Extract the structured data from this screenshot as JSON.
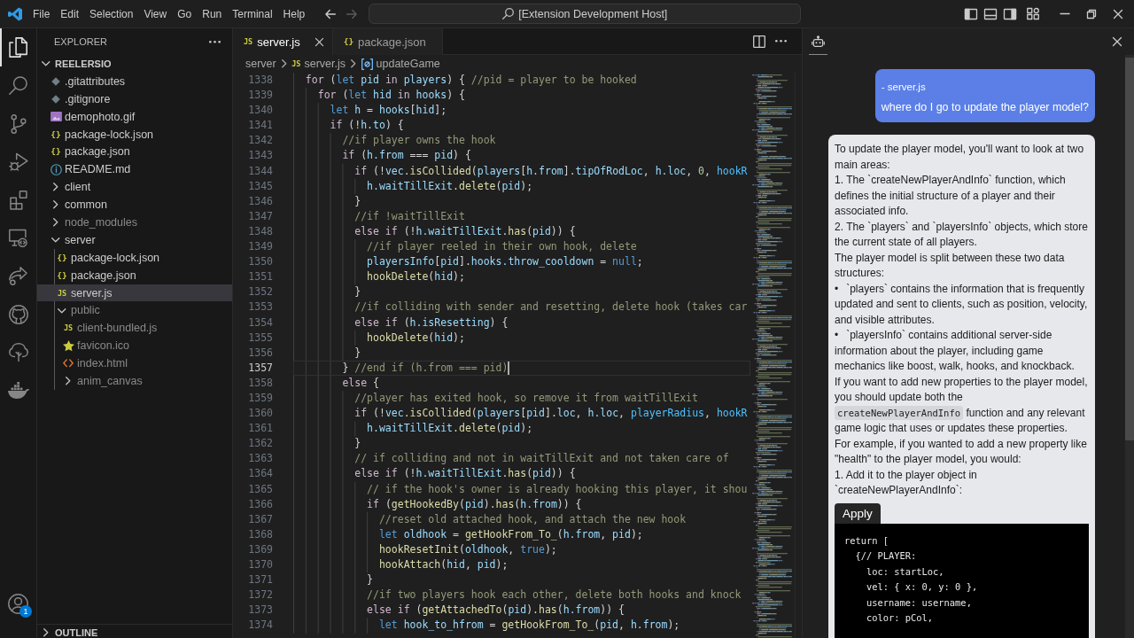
{
  "title_bar": {
    "menu": [
      "File",
      "Edit",
      "Selection",
      "View",
      "Go",
      "Run",
      "Terminal",
      "Help"
    ],
    "navigation": [
      {
        "kind": "back",
        "disabled": false
      },
      {
        "kind": "forward",
        "disabled": true
      }
    ],
    "command_center": "[Extension Development Host]"
  },
  "activity_bar": {
    "items": [
      {
        "kind": "explorer",
        "selected": true
      },
      {
        "kind": "search",
        "selected": false
      },
      {
        "kind": "source_control",
        "selected": false
      },
      {
        "kind": "run_debug",
        "selected": false
      },
      {
        "kind": "extensions",
        "selected": false
      },
      {
        "kind": "remote",
        "selected": false
      },
      {
        "kind": "share",
        "selected": false
      },
      {
        "kind": "github",
        "selected": false
      },
      {
        "kind": "tree",
        "selected": false
      },
      {
        "kind": "docker",
        "selected": false
      }
    ],
    "account_badge": "1"
  },
  "sidebar": {
    "title": "EXPLORER",
    "tree": {
      "label": "REELERSIO",
      "expanded": true,
      "children": [
        {
          "label": ".gitattributes",
          "kind": "config",
          "selected": false,
          "dimmed": false
        },
        {
          "label": ".gitignore",
          "kind": "config",
          "selected": false,
          "dimmed": false
        },
        {
          "label": "demophoto.gif",
          "kind": "image",
          "selected": false,
          "dimmed": false
        },
        {
          "label": "package-lock.json",
          "kind": "json",
          "icon_label": "{}",
          "selected": false,
          "dimmed": false
        },
        {
          "label": "package.json",
          "kind": "json",
          "icon_label": "{}",
          "selected": false,
          "dimmed": false
        },
        {
          "label": "README.md",
          "kind": "info",
          "selected": false,
          "dimmed": false
        },
        {
          "label": "client",
          "kind": "folder",
          "expanded": false,
          "selected": false,
          "dimmed": false
        },
        {
          "label": "common",
          "kind": "folder",
          "expanded": false,
          "selected": false,
          "dimmed": false
        },
        {
          "label": "node_modules",
          "kind": "folder",
          "expanded": false,
          "selected": false,
          "dimmed": true
        },
        {
          "label": "server",
          "kind": "folder",
          "expanded": true,
          "selected": false,
          "dimmed": false,
          "children": [
            {
              "label": "package-lock.json",
              "kind": "json",
              "icon_label": "{}",
              "selected": false,
              "dimmed": false
            },
            {
              "label": "package.json",
              "kind": "json",
              "icon_label": "{}",
              "selected": false,
              "dimmed": false
            },
            {
              "label": "server.js",
              "kind": "javascript",
              "icon_label": "JS",
              "selected": true,
              "dimmed": false
            },
            {
              "label": "public",
              "kind": "folder",
              "expanded": true,
              "selected": false,
              "dimmed": true,
              "children": [
                {
                  "label": "client-bundled.js",
                  "kind": "javascript",
                  "icon_label": "JS",
                  "selected": false,
                  "dimmed": true
                },
                {
                  "label": "favicon.ico",
                  "kind": "favicon",
                  "selected": false,
                  "dimmed": true
                },
                {
                  "label": "index.html",
                  "kind": "html",
                  "selected": false,
                  "dimmed": true
                },
                {
                  "label": "anim_canvas",
                  "kind": "folder",
                  "expanded": false,
                  "selected": false,
                  "dimmed": true
                }
              ]
            }
          ]
        }
      ]
    },
    "outline": {
      "label": "OUTLINE",
      "expanded": false
    }
  },
  "editor": {
    "tabs": [
      {
        "label": "server.js",
        "kind": "javascript",
        "icon_label": "JS",
        "selected": true
      },
      {
        "label": "package.json",
        "kind": "json",
        "icon_label": "{}",
        "selected": false
      }
    ],
    "breadcrumbs": [
      {
        "label": "server",
        "kind": "folder"
      },
      {
        "label": "server.js",
        "kind": "javascript",
        "icon_label": "JS"
      },
      {
        "label": "updateGame",
        "kind": "symbol"
      }
    ],
    "lines": [
      {
        "number": "1338",
        "current": false,
        "tokens": [
          {
            "kind": "control",
            "text": "  for"
          },
          {
            "kind": "plain",
            "text": " ("
          },
          {
            "kind": "keyword",
            "text": "let"
          },
          {
            "kind": "variable",
            "text": " pid"
          },
          {
            "kind": "control",
            "text": " in"
          },
          {
            "kind": "variable",
            "text": " players"
          },
          {
            "kind": "plain",
            "text": ") { "
          },
          {
            "kind": "comment",
            "text": "//pid = player to be hooked"
          }
        ]
      },
      {
        "number": "1339",
        "current": false,
        "tokens": [
          {
            "kind": "control",
            "text": "    for"
          },
          {
            "kind": "plain",
            "text": " ("
          },
          {
            "kind": "keyword",
            "text": "let"
          },
          {
            "kind": "variable",
            "text": " hid"
          },
          {
            "kind": "control",
            "text": " in"
          },
          {
            "kind": "variable",
            "text": " hooks"
          },
          {
            "kind": "plain",
            "text": ") {"
          }
        ]
      },
      {
        "number": "1340",
        "current": false,
        "tokens": [
          {
            "kind": "keyword",
            "text": "      let"
          },
          {
            "kind": "variable",
            "text": " h"
          },
          {
            "kind": "plain",
            "text": " = "
          },
          {
            "kind": "variable",
            "text": "hooks"
          },
          {
            "kind": "plain",
            "text": "["
          },
          {
            "kind": "variable",
            "text": "hid"
          },
          {
            "kind": "plain",
            "text": "];"
          }
        ]
      },
      {
        "number": "1341",
        "current": false,
        "tokens": [
          {
            "kind": "control",
            "text": "      if"
          },
          {
            "kind": "plain",
            "text": " (!"
          },
          {
            "kind": "variable",
            "text": "h.to"
          },
          {
            "kind": "plain",
            "text": ") {"
          }
        ]
      },
      {
        "number": "1342",
        "current": false,
        "tokens": [
          {
            "kind": "comment",
            "text": "        //if player owns the hook"
          }
        ]
      },
      {
        "number": "1343",
        "current": false,
        "tokens": [
          {
            "kind": "control",
            "text": "        if"
          },
          {
            "kind": "plain",
            "text": " ("
          },
          {
            "kind": "variable",
            "text": "h.from"
          },
          {
            "kind": "plain",
            "text": " === "
          },
          {
            "kind": "variable",
            "text": "pid"
          },
          {
            "kind": "plain",
            "text": ") {"
          }
        ]
      },
      {
        "number": "1344",
        "current": false,
        "tokens": [
          {
            "kind": "control",
            "text": "          if"
          },
          {
            "kind": "plain",
            "text": " (!"
          },
          {
            "kind": "variable",
            "text": "vec"
          },
          {
            "kind": "function",
            "text": ".isCollided"
          },
          {
            "kind": "plain",
            "text": "("
          },
          {
            "kind": "variable",
            "text": "players"
          },
          {
            "kind": "plain",
            "text": "["
          },
          {
            "kind": "variable",
            "text": "h.from"
          },
          {
            "kind": "plain",
            "text": "]."
          },
          {
            "kind": "variable",
            "text": "tipOfRodLoc"
          },
          {
            "kind": "plain",
            "text": ", "
          },
          {
            "kind": "variable",
            "text": "h.loc"
          },
          {
            "kind": "plain",
            "text": ", "
          },
          {
            "kind": "number",
            "text": "0"
          },
          {
            "kind": "plain",
            "text": ", "
          },
          {
            "kind": "constant",
            "text": "hookR"
          }
        ]
      },
      {
        "number": "1345",
        "current": false,
        "tokens": [
          {
            "kind": "variable",
            "text": "            h.waitTillExit"
          },
          {
            "kind": "function",
            "text": ".delete"
          },
          {
            "kind": "plain",
            "text": "("
          },
          {
            "kind": "variable",
            "text": "pid"
          },
          {
            "kind": "plain",
            "text": ");"
          }
        ]
      },
      {
        "number": "1346",
        "current": false,
        "tokens": [
          {
            "kind": "plain",
            "text": "          }"
          }
        ]
      },
      {
        "number": "1347",
        "current": false,
        "tokens": [
          {
            "kind": "comment",
            "text": "          //if !waitTillExit"
          }
        ]
      },
      {
        "number": "1348",
        "current": false,
        "tokens": [
          {
            "kind": "control",
            "text": "          else if"
          },
          {
            "kind": "plain",
            "text": " (!"
          },
          {
            "kind": "variable",
            "text": "h.waitTillExit"
          },
          {
            "kind": "function",
            "text": ".has"
          },
          {
            "kind": "plain",
            "text": "("
          },
          {
            "kind": "variable",
            "text": "pid"
          },
          {
            "kind": "plain",
            "text": ")) {"
          }
        ]
      },
      {
        "number": "1349",
        "current": false,
        "tokens": [
          {
            "kind": "comment",
            "text": "            //if player reeled in their own hook, delete"
          }
        ]
      },
      {
        "number": "1350",
        "current": false,
        "tokens": [
          {
            "kind": "variable",
            "text": "            playersInfo"
          },
          {
            "kind": "plain",
            "text": "["
          },
          {
            "kind": "variable",
            "text": "pid"
          },
          {
            "kind": "plain",
            "text": "]."
          },
          {
            "kind": "variable",
            "text": "hooks.throw_cooldown"
          },
          {
            "kind": "plain",
            "text": " = "
          },
          {
            "kind": "keyword",
            "text": "null"
          },
          {
            "kind": "plain",
            "text": ";"
          }
        ]
      },
      {
        "number": "1351",
        "current": false,
        "tokens": [
          {
            "kind": "function",
            "text": "            hookDelete"
          },
          {
            "kind": "plain",
            "text": "("
          },
          {
            "kind": "variable",
            "text": "hid"
          },
          {
            "kind": "plain",
            "text": ");"
          }
        ]
      },
      {
        "number": "1352",
        "current": false,
        "tokens": [
          {
            "kind": "plain",
            "text": "          }"
          }
        ]
      },
      {
        "number": "1353",
        "current": false,
        "tokens": [
          {
            "kind": "comment",
            "text": "          //if colliding with sender and resetting, delete hook (takes car"
          }
        ]
      },
      {
        "number": "1354",
        "current": false,
        "tokens": [
          {
            "kind": "control",
            "text": "          else if"
          },
          {
            "kind": "plain",
            "text": " ("
          },
          {
            "kind": "variable",
            "text": "h.isResetting"
          },
          {
            "kind": "plain",
            "text": ") {"
          }
        ]
      },
      {
        "number": "1355",
        "current": false,
        "tokens": [
          {
            "kind": "function",
            "text": "            hookDelete"
          },
          {
            "kind": "plain",
            "text": "("
          },
          {
            "kind": "variable",
            "text": "hid"
          },
          {
            "kind": "plain",
            "text": ");"
          }
        ]
      },
      {
        "number": "1356",
        "current": false,
        "tokens": [
          {
            "kind": "plain",
            "text": "          }"
          }
        ]
      },
      {
        "number": "1357",
        "current": true,
        "tokens": [
          {
            "kind": "plain",
            "text": "        } "
          },
          {
            "kind": "comment",
            "text": "//end if (h.from === pid)"
          }
        ]
      },
      {
        "number": "1358",
        "current": false,
        "tokens": [
          {
            "kind": "control",
            "text": "        else"
          },
          {
            "kind": "plain",
            "text": " {"
          }
        ]
      },
      {
        "number": "1359",
        "current": false,
        "tokens": [
          {
            "kind": "comment",
            "text": "          //player has exited hook, so remove it from waitTillExit"
          }
        ]
      },
      {
        "number": "1360",
        "current": false,
        "tokens": [
          {
            "kind": "control",
            "text": "          if"
          },
          {
            "kind": "plain",
            "text": " (!"
          },
          {
            "kind": "variable",
            "text": "vec"
          },
          {
            "kind": "function",
            "text": ".isCollided"
          },
          {
            "kind": "plain",
            "text": "("
          },
          {
            "kind": "variable",
            "text": "players"
          },
          {
            "kind": "plain",
            "text": "["
          },
          {
            "kind": "variable",
            "text": "pid"
          },
          {
            "kind": "plain",
            "text": "]."
          },
          {
            "kind": "variable",
            "text": "loc"
          },
          {
            "kind": "plain",
            "text": ", "
          },
          {
            "kind": "variable",
            "text": "h.loc"
          },
          {
            "kind": "plain",
            "text": ", "
          },
          {
            "kind": "constant",
            "text": "playerRadius"
          },
          {
            "kind": "plain",
            "text": ", "
          },
          {
            "kind": "constant",
            "text": "hookR"
          }
        ]
      },
      {
        "number": "1361",
        "current": false,
        "tokens": [
          {
            "kind": "variable",
            "text": "            h.waitTillExit"
          },
          {
            "kind": "function",
            "text": ".delete"
          },
          {
            "kind": "plain",
            "text": "("
          },
          {
            "kind": "variable",
            "text": "pid"
          },
          {
            "kind": "plain",
            "text": ");"
          }
        ]
      },
      {
        "number": "1362",
        "current": false,
        "tokens": [
          {
            "kind": "plain",
            "text": "          }"
          }
        ]
      },
      {
        "number": "1363",
        "current": false,
        "tokens": [
          {
            "kind": "comment",
            "text": "          // if colliding and not in waitTillExit and not taken care of"
          }
        ]
      },
      {
        "number": "1364",
        "current": false,
        "tokens": [
          {
            "kind": "control",
            "text": "          else if"
          },
          {
            "kind": "plain",
            "text": " (!"
          },
          {
            "kind": "variable",
            "text": "h.waitTillExit"
          },
          {
            "kind": "function",
            "text": ".has"
          },
          {
            "kind": "plain",
            "text": "("
          },
          {
            "kind": "variable",
            "text": "pid"
          },
          {
            "kind": "plain",
            "text": ")) {"
          }
        ]
      },
      {
        "number": "1365",
        "current": false,
        "tokens": [
          {
            "kind": "comment",
            "text": "            // if the hook's owner is already hooking this player, it shou"
          }
        ]
      },
      {
        "number": "1366",
        "current": false,
        "tokens": [
          {
            "kind": "control",
            "text": "            if"
          },
          {
            "kind": "plain",
            "text": " ("
          },
          {
            "kind": "function",
            "text": "getHookedBy"
          },
          {
            "kind": "plain",
            "text": "("
          },
          {
            "kind": "variable",
            "text": "pid"
          },
          {
            "kind": "plain",
            "text": ")"
          },
          {
            "kind": "function",
            "text": ".has"
          },
          {
            "kind": "plain",
            "text": "("
          },
          {
            "kind": "variable",
            "text": "h.from"
          },
          {
            "kind": "plain",
            "text": ")) {"
          }
        ]
      },
      {
        "number": "1367",
        "current": false,
        "tokens": [
          {
            "kind": "comment",
            "text": "              //reset old attached hook, and attach the new hook"
          }
        ]
      },
      {
        "number": "1368",
        "current": false,
        "tokens": [
          {
            "kind": "keyword",
            "text": "              let"
          },
          {
            "kind": "variable",
            "text": " oldhook"
          },
          {
            "kind": "plain",
            "text": " = "
          },
          {
            "kind": "function",
            "text": "getHookFrom_To_"
          },
          {
            "kind": "plain",
            "text": "("
          },
          {
            "kind": "variable",
            "text": "h.from"
          },
          {
            "kind": "plain",
            "text": ", "
          },
          {
            "kind": "variable",
            "text": "pid"
          },
          {
            "kind": "plain",
            "text": ");"
          }
        ]
      },
      {
        "number": "1369",
        "current": false,
        "tokens": [
          {
            "kind": "function",
            "text": "              hookResetInit"
          },
          {
            "kind": "plain",
            "text": "("
          },
          {
            "kind": "variable",
            "text": "oldhook"
          },
          {
            "kind": "plain",
            "text": ", "
          },
          {
            "kind": "keyword",
            "text": "true"
          },
          {
            "kind": "plain",
            "text": ");"
          }
        ]
      },
      {
        "number": "1370",
        "current": false,
        "tokens": [
          {
            "kind": "function",
            "text": "              hookAttach"
          },
          {
            "kind": "plain",
            "text": "("
          },
          {
            "kind": "variable",
            "text": "hid"
          },
          {
            "kind": "plain",
            "text": ", "
          },
          {
            "kind": "variable",
            "text": "pid"
          },
          {
            "kind": "plain",
            "text": ");"
          }
        ]
      },
      {
        "number": "1371",
        "current": false,
        "tokens": [
          {
            "kind": "plain",
            "text": "            }"
          }
        ]
      },
      {
        "number": "1372",
        "current": false,
        "tokens": [
          {
            "kind": "comment",
            "text": "            //if two players hook each other, delete both hooks and knock"
          }
        ]
      },
      {
        "number": "1373",
        "current": false,
        "tokens": [
          {
            "kind": "control",
            "text": "            else if"
          },
          {
            "kind": "plain",
            "text": " ("
          },
          {
            "kind": "function",
            "text": "getAttachedTo"
          },
          {
            "kind": "plain",
            "text": "("
          },
          {
            "kind": "variable",
            "text": "pid"
          },
          {
            "kind": "plain",
            "text": ")"
          },
          {
            "kind": "function",
            "text": ".has"
          },
          {
            "kind": "plain",
            "text": "("
          },
          {
            "kind": "variable",
            "text": "h.from"
          },
          {
            "kind": "plain",
            "text": ")) {"
          }
        ]
      },
      {
        "number": "1374",
        "current": false,
        "tokens": [
          {
            "kind": "keyword",
            "text": "              let"
          },
          {
            "kind": "variable",
            "text": " hook_to_hfrom"
          },
          {
            "kind": "plain",
            "text": " = "
          },
          {
            "kind": "function",
            "text": "getHookFrom_To_"
          },
          {
            "kind": "plain",
            "text": "("
          },
          {
            "kind": "variable",
            "text": "pid"
          },
          {
            "kind": "plain",
            "text": ", "
          },
          {
            "kind": "variable",
            "text": "h.from"
          },
          {
            "kind": "plain",
            "text": ");"
          }
        ]
      }
    ]
  },
  "chat": {
    "header_tab": {
      "selected": true
    },
    "messages": [
      {
        "kind": "user",
        "context": "- server.js",
        "text": "where do I go to update the player model?"
      },
      {
        "kind": "assistant",
        "blocks": [
          {
            "kind": "paragraph",
            "parts": [
              {
                "kind": "text",
                "text": "To update the player model, you'll want to look at two main areas:"
              }
            ]
          },
          {
            "kind": "paragraph",
            "parts": [
              {
                "kind": "text",
                "text": "1. The `createNewPlayerAndInfo` function, which defines the initial structure of a player and their associated info."
              }
            ]
          },
          {
            "kind": "paragraph",
            "parts": [
              {
                "kind": "text",
                "text": "2. The `players` and `playersInfo` objects, which store the current state of all players."
              }
            ]
          },
          {
            "kind": "paragraph",
            "parts": [
              {
                "kind": "text",
                "text": "The player model is split between these two data structures:"
              }
            ]
          },
          {
            "kind": "bullet",
            "marker": "•",
            "parts": [
              {
                "kind": "text",
                "text": "`players` contains the information that is frequently updated and sent to clients, such as position, velocity, and visible attributes."
              }
            ]
          },
          {
            "kind": "bullet",
            "marker": "•",
            "parts": [
              {
                "kind": "text",
                "text": "`playersInfo` contains additional server-side information about the player, including game mechanics like boost, walk, hooks, and knockback."
              }
            ]
          },
          {
            "kind": "paragraph",
            "parts": [
              {
                "kind": "text",
                "text": "If you want to add new properties to the player model, you should update both the "
              },
              {
                "kind": "code",
                "text": "createNewPlayerAndInfo"
              },
              {
                "kind": "text",
                "text": " function and any relevant game logic that uses or updates these properties."
              }
            ]
          },
          {
            "kind": "paragraph",
            "parts": [
              {
                "kind": "text",
                "text": "For example, if you wanted to add a new property like \"health\" to the player model, you would:"
              }
            ]
          },
          {
            "kind": "paragraph",
            "parts": [
              {
                "kind": "text",
                "text": "1. Add it to the player object in `createNewPlayerAndInfo`:"
              }
            ]
          },
          {
            "kind": "code_block",
            "action": "Apply",
            "lines": [
              "return [",
              "  {// PLAYER:",
              "    loc: startLoc,",
              "    vel: { x: 0, y: 0 },",
              "    username: username,",
              "    color: pCol,"
            ]
          }
        ]
      }
    ]
  }
}
